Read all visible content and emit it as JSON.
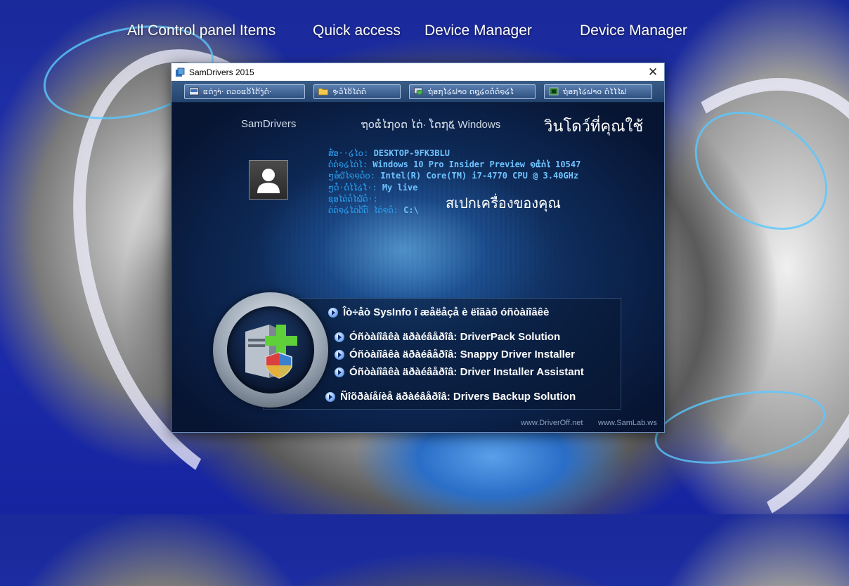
{
  "desktop": {
    "links": [
      "All Control panel Items",
      "Quick access",
      "Device Manager",
      "Device Manager"
    ]
  },
  "window": {
    "title": "SamDrivers 2015",
    "close_glyph": "✕",
    "toolbar": [
      {
        "label": "ແດ່ງາ່· ດວ໐ແ໐້ໄດ້ງ່ດ່ໍ·",
        "icon": "drive-window-icon"
      },
      {
        "label": "ຯວ໋ໄ໐້ໄດ່ດໍໍ",
        "icon": "folder-icon"
      },
      {
        "label": "ຖ່ອ໗ໄ໒ຝາ໐ ດ໘໒໐ດ໋ດ໋໑໒ໄ",
        "icon": "monitor-shield-icon"
      },
      {
        "label": "ຖ່ອ໗ໄ໒ຝາ໐ ດໍ່ໄໄໄຟ",
        "icon": "chip-icon"
      }
    ]
  },
  "content": {
    "brand": "SamDrivers",
    "os_label": "ຖ໐ແ໋ໄ໗໐ດ ໄດ່· ໂດ໗໕ Windows",
    "thai_windows": "วินโดว์ที่คุณใช้",
    "thai_spec": "สเปกเครื่องของคุณ",
    "info": [
      {
        "k": "ສ໋ອ··໒ໄ໐: ",
        "v": "DESKTOP-9FK3BLU"
      },
      {
        "k": "ດ່ດ່໑໒ໄດ່ໄ: ",
        "v": "Windows 10 Pro Insider Preview  ໑ແ໋ດ່ໄ 10547"
      },
      {
        "k": "ໆອ໋໖ໄ໑໑ດ໋໐: ",
        "v": "Intel(R) Core(TM) i7-4770 CPU @ 3.40GHz"
      },
      {
        "k": "ໆດ່໋·ດ່ໍໄໄ໒ໄໍ·: ",
        "v": "My live"
      },
      {
        "k": "ຊອໄດ່ດ໋ໄ໖ດ໋·: ",
        "v": ""
      },
      {
        "k": "ດ່ດ່໑໒ໄດ່ດ້ດ໌ ໄດ່໑ດ໋: ",
        "v": "C:\\"
      }
    ],
    "menu": [
      "Îò÷åò SysInfo î æåëåçå è ëîãàõ óñòàíîâêè",
      "Óñòàíîâêà äðàéâåðîâ: DriverPack Solution",
      "Óñòàíîâêà äðàéâåðîâ: Snappy Driver Installer",
      "Óñòàíîâêà äðàéâåðîâ: Driver Installer Assistant",
      "Ñîõðàíåíèå äðàéâåðîâ: Drivers Backup Solution"
    ],
    "footer": [
      "www.DriverOff.net",
      "www.SamLab.ws"
    ]
  }
}
